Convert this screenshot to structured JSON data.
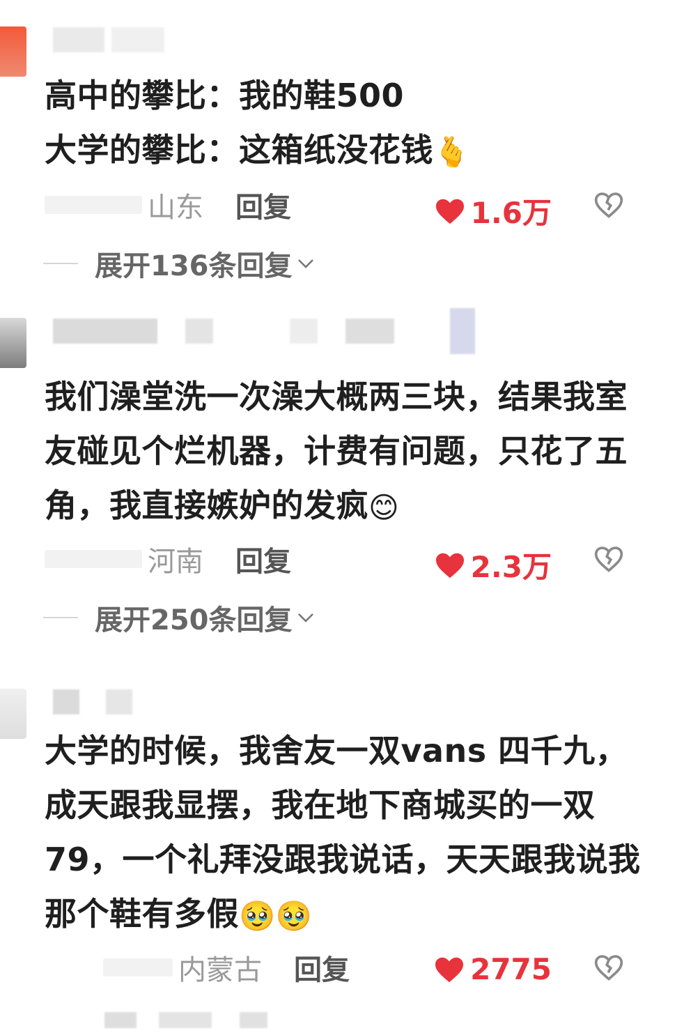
{
  "colors": {
    "like_red": "#e8323c",
    "text": "#1f1f1f",
    "muted": "#9a9a9a"
  },
  "comments": [
    {
      "line1": "高中的攀比：我的鞋500",
      "line2": "大学的攀比：这箱纸没花钱",
      "emoji": "🫰",
      "location": "山东",
      "reply_label": "回复",
      "likes": "1.6万",
      "expand_label": "展开136条回复"
    },
    {
      "line1": "我们澡堂洗一次澡大概两三块，结果我室",
      "line2": "友碰见个烂机器，计费有问题，只花了五",
      "line3": "角，我直接嫉妒的发疯",
      "emoji": "😊",
      "location": "河南",
      "reply_label": "回复",
      "likes": "2.3万",
      "expand_label": "展开250条回复"
    },
    {
      "line1": "大学的时候，我舍友一双vans 四千九，",
      "line2": "成天跟我显摆，我在地下商城买的一双",
      "line3": "79，一个礼拜没跟我说话，天天跟我说我",
      "line4": "那个鞋有多假",
      "emoji": "🥹🥹",
      "location": "内蒙古",
      "reply_label": "回复",
      "likes": "2775"
    }
  ]
}
